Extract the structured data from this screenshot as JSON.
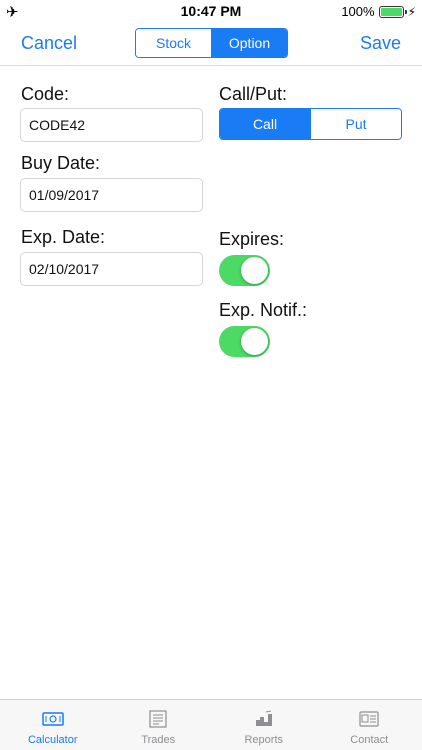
{
  "status_bar": {
    "time": "10:47 PM",
    "battery": "100%",
    "airplane_icon": "airplane-icon",
    "battery_level": 1.0
  },
  "nav": {
    "cancel_label": "Cancel",
    "save_label": "Save",
    "segments": [
      "Stock",
      "Option"
    ],
    "selected_segment": "Option"
  },
  "form": {
    "code_label": "Code:",
    "code_value": "CODE42",
    "buy_date_label": "Buy Date:",
    "buy_date_value": "01/09/2017",
    "exp_date_label": "Exp. Date:",
    "exp_date_value": "02/10/2017",
    "call_put_label": "Call/Put:",
    "call_put_options": [
      "Call",
      "Put"
    ],
    "call_put_selected": "Call",
    "expires_label": "Expires:",
    "expires_on": true,
    "exp_notif_label": "Exp. Notif.:",
    "exp_notif_on": true
  },
  "tabs": [
    {
      "label": "Calculator",
      "icon": "calculator-icon",
      "active": true
    },
    {
      "label": "Trades",
      "icon": "trades-icon",
      "active": false
    },
    {
      "label": "Reports",
      "icon": "reports-icon",
      "active": false
    },
    {
      "label": "Contact",
      "icon": "contact-icon",
      "active": false
    }
  ],
  "colors": {
    "accent": "#1a7cf4",
    "toggle_on": "#4cd964",
    "tab_inactive": "#8e8e93"
  }
}
